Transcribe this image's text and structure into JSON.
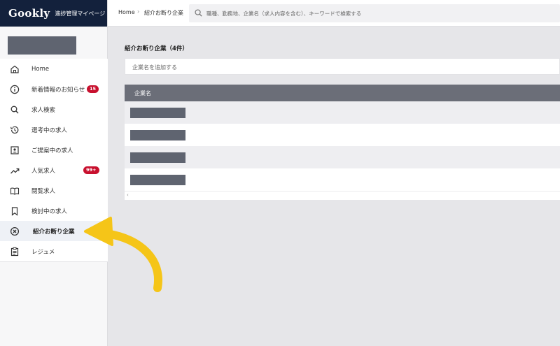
{
  "brand": {
    "logo": "Gookly",
    "subtitle": "進捗管理マイページ"
  },
  "breadcrumb": {
    "home": "Home",
    "current": "紹介お断り企業"
  },
  "search": {
    "placeholder": "職種、勤務地、企業名（求人内容を含む）、キーワードで検索する"
  },
  "nav": {
    "items": [
      {
        "label": "Home",
        "icon": "home-icon"
      },
      {
        "label": "新着情報のお知らせ",
        "icon": "info-icon",
        "badge": "15"
      },
      {
        "label": "求人検索",
        "icon": "search-icon"
      },
      {
        "label": "選考中の求人",
        "icon": "history-icon"
      },
      {
        "label": "ご提案中の求人",
        "icon": "contact-card-icon"
      },
      {
        "label": "人気求人",
        "icon": "trending-icon",
        "badge": "99+"
      },
      {
        "label": "閲覧求人",
        "icon": "book-icon"
      },
      {
        "label": "検討中の求人",
        "icon": "bookmark-icon"
      },
      {
        "label": "紹介お断り企業",
        "icon": "circle-x-icon",
        "active": true
      },
      {
        "label": "レジュメ",
        "icon": "clipboard-icon"
      }
    ]
  },
  "main": {
    "title": "紹介お断り企業（4件）",
    "add_placeholder": "企業名を追加する",
    "table": {
      "header": "企業名",
      "rows": 4
    }
  },
  "colors": {
    "brand_bg": "#13213c",
    "badge": "#c8102e",
    "arrow": "#f5c518",
    "table_header": "#6b6e78"
  }
}
